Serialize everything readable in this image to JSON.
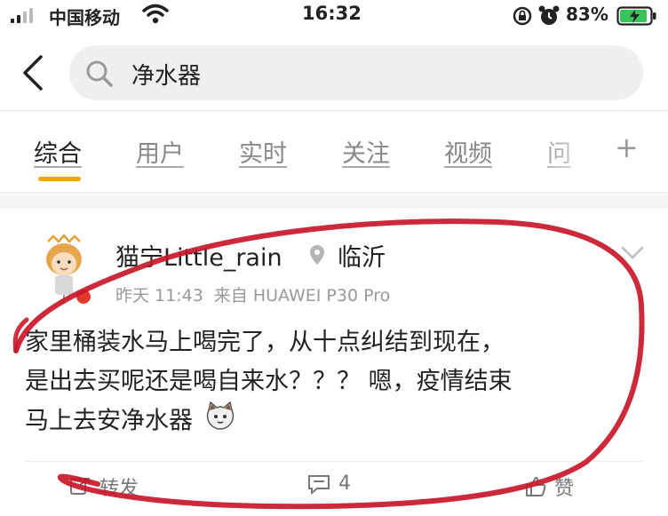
{
  "status_bar": {
    "carrier": "中国移动",
    "time": "16:32",
    "battery_percent": "83%"
  },
  "search": {
    "query": "净水器",
    "icons": [
      "back-chevron-icon",
      "search-icon"
    ]
  },
  "tabs": [
    {
      "label": "综合",
      "active": true
    },
    {
      "label": "用户",
      "active": false
    },
    {
      "label": "实时",
      "active": false
    },
    {
      "label": "关注",
      "active": false
    },
    {
      "label": "视频",
      "active": false
    },
    {
      "label": "问",
      "active": false
    }
  ],
  "tab_add_label": "+",
  "post": {
    "author": "猫宁Little_rain",
    "location": "临沂",
    "time": "昨天 11:43",
    "source": "来自 HUAWEI P30 Pro",
    "body_lines": [
      "家里桶装水马上喝完了，从十点纠结到现在，",
      "是出去买呢还是喝自来水？？？ 嗯，疫情结束",
      "马上去安净水器"
    ],
    "actions": {
      "repost": "转发",
      "comment_count": "4",
      "like": "赞"
    }
  },
  "colors": {
    "accent_tab_indicator": "#f0a500",
    "annotation_circle": "#c8182a",
    "vip_badge": "#e03a2f"
  }
}
